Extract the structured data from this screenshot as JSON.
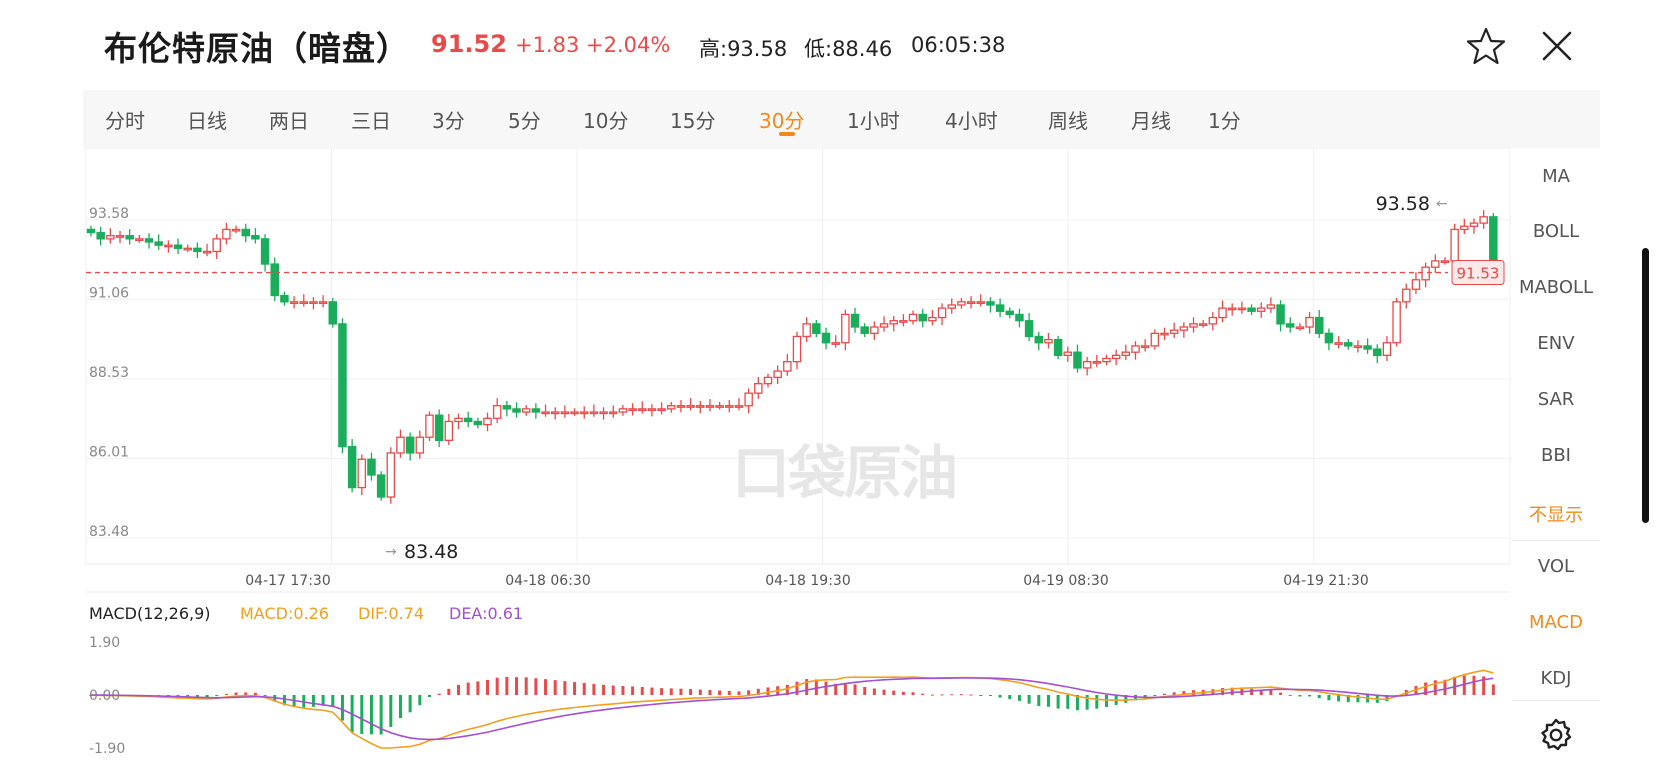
{
  "header": {
    "title": "布伦特原油（暗盘）",
    "price": "91.52",
    "change": "+1.83 +2.04%",
    "high": "高:93.58",
    "low": "低:88.46",
    "time": "06:05:38"
  },
  "tabs": [
    "分时",
    "日线",
    "两日",
    "三日",
    "3分",
    "5分",
    "10分",
    "15分",
    "30分",
    "1小时",
    "4小时",
    "周线",
    "月线",
    "1分"
  ],
  "active_tab": "30分",
  "right_panel": {
    "main_indicators": [
      "MA",
      "BOLL",
      "MABOLL",
      "ENV",
      "SAR",
      "BBI",
      "不显示"
    ],
    "active_main": "不显示",
    "sub_indicators": [
      "VOL",
      "MACD",
      "KDJ"
    ],
    "active_sub": "MACD"
  },
  "colors": {
    "up": "#e84a4a",
    "down": "#1aad5c",
    "accent": "#f08a1c",
    "macd": "#f0a020",
    "dif": "#f0a020",
    "dea": "#a24fd0"
  },
  "watermark": "口袋原油",
  "chart_data": {
    "type": "candlestick",
    "y_ticks": [
      "93.58",
      "91.06",
      "88.53",
      "86.01",
      "83.48"
    ],
    "x_ticks": [
      "04-17 17:30",
      "04-18 06:30",
      "04-18 19:30",
      "04-19 08:30",
      "04-19 21:30"
    ],
    "ylim": [
      83.48,
      93.58
    ],
    "max_label": "93.58",
    "min_label": "83.48",
    "last_price": "91.53",
    "closes": [
      92.8,
      92.6,
      92.7,
      92.7,
      92.6,
      92.6,
      92.5,
      92.4,
      92.4,
      92.3,
      92.3,
      92.2,
      92.2,
      92.6,
      92.9,
      92.9,
      92.7,
      92.6,
      91.8,
      90.8,
      90.6,
      90.6,
      90.6,
      90.6,
      90.6,
      89.9,
      86.0,
      84.7,
      85.6,
      85.1,
      84.4,
      85.8,
      86.3,
      85.8,
      86.3,
      87.0,
      86.2,
      86.8,
      86.9,
      86.8,
      86.7,
      86.9,
      87.3,
      87.2,
      87.1,
      87.2,
      87.1,
      87.1,
      87.1,
      87.1,
      87.1,
      87.1,
      87.1,
      87.1,
      87.1,
      87.2,
      87.2,
      87.2,
      87.2,
      87.2,
      87.3,
      87.3,
      87.3,
      87.3,
      87.3,
      87.3,
      87.3,
      87.3,
      87.7,
      88.0,
      88.2,
      88.4,
      88.7,
      89.5,
      89.9,
      89.6,
      89.3,
      89.3,
      90.2,
      89.8,
      89.6,
      89.8,
      89.9,
      90.0,
      90.0,
      90.2,
      90.0,
      90.1,
      90.4,
      90.5,
      90.6,
      90.6,
      90.6,
      90.5,
      90.3,
      90.2,
      90.0,
      89.5,
      89.3,
      89.4,
      88.9,
      89.0,
      88.5,
      88.7,
      88.7,
      88.8,
      88.9,
      89.0,
      89.2,
      89.2,
      89.6,
      89.6,
      89.7,
      89.8,
      89.9,
      89.9,
      90.1,
      90.4,
      90.4,
      90.4,
      90.3,
      90.4,
      90.5,
      89.9,
      89.8,
      89.8,
      90.1,
      89.6,
      89.3,
      89.3,
      89.2,
      89.2,
      89.1,
      88.9,
      89.3,
      90.6,
      91.0,
      91.3,
      91.7,
      91.9,
      91.9,
      92.9,
      93.0,
      93.1,
      93.3,
      91.5
    ],
    "macd": {
      "label": "MACD(12,26,9)",
      "macd_value": "MACD:0.26",
      "dif_value": "DIF:0.74",
      "dea_value": "DEA:0.61",
      "y_ticks": [
        "1.90",
        "0.00",
        "-1.90"
      ],
      "ylim": [
        -1.9,
        1.9
      ]
    }
  }
}
